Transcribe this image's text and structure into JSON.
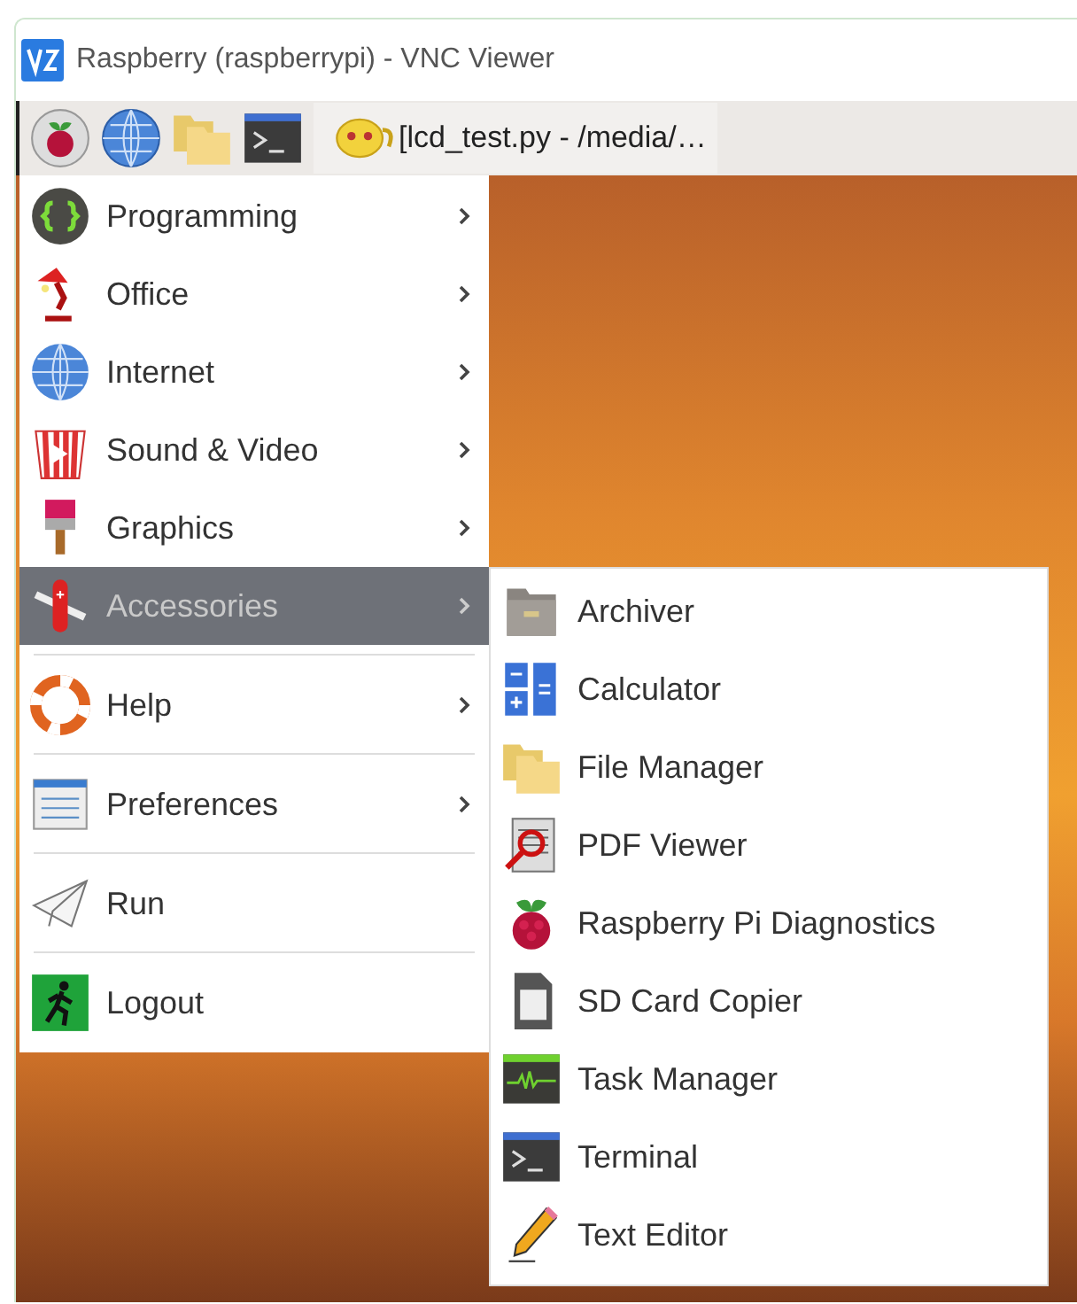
{
  "window": {
    "title": "Raspberry (raspberrypi) - VNC Viewer"
  },
  "taskbar": {
    "task_button": "[lcd_test.py - /media/…"
  },
  "main_menu": [
    {
      "label": "Programming",
      "has_submenu": true,
      "selected": false,
      "separator_before": false
    },
    {
      "label": "Office",
      "has_submenu": true,
      "selected": false,
      "separator_before": false
    },
    {
      "label": "Internet",
      "has_submenu": true,
      "selected": false,
      "separator_before": false
    },
    {
      "label": "Sound & Video",
      "has_submenu": true,
      "selected": false,
      "separator_before": false
    },
    {
      "label": "Graphics",
      "has_submenu": true,
      "selected": false,
      "separator_before": false
    },
    {
      "label": "Accessories",
      "has_submenu": true,
      "selected": true,
      "separator_before": false
    },
    {
      "label": "Help",
      "has_submenu": true,
      "selected": false,
      "separator_before": true
    },
    {
      "label": "Preferences",
      "has_submenu": true,
      "selected": false,
      "separator_before": true
    },
    {
      "label": "Run",
      "has_submenu": false,
      "selected": false,
      "separator_before": true
    },
    {
      "label": "Logout",
      "has_submenu": false,
      "selected": false,
      "separator_before": true
    }
  ],
  "submenu": [
    {
      "label": "Archiver"
    },
    {
      "label": "Calculator"
    },
    {
      "label": "File Manager"
    },
    {
      "label": "PDF Viewer"
    },
    {
      "label": "Raspberry Pi Diagnostics"
    },
    {
      "label": "SD Card Copier"
    },
    {
      "label": "Task Manager"
    },
    {
      "label": "Terminal"
    },
    {
      "label": "Text Editor"
    }
  ]
}
